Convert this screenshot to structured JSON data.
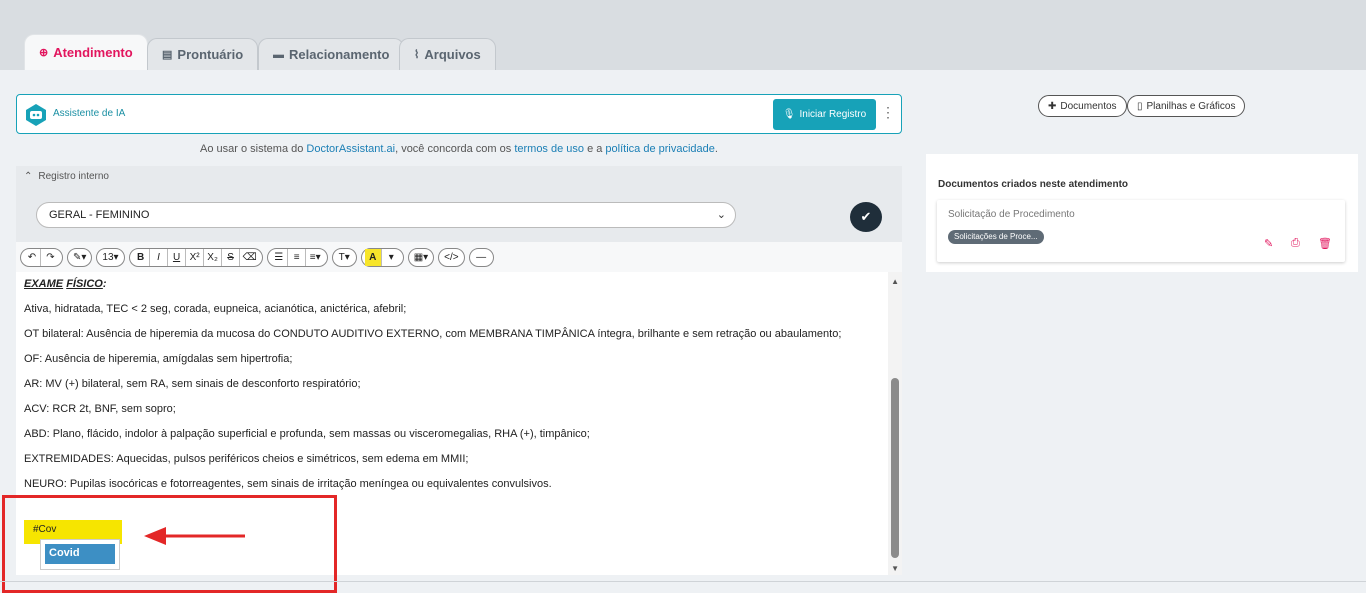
{
  "tabs": [
    {
      "label": "Atendimento",
      "icon": "stethoscope-icon",
      "active": true
    },
    {
      "label": "Prontuário",
      "icon": "document-icon",
      "active": false
    },
    {
      "label": "Relacionamento",
      "icon": "chat-icon",
      "active": false
    },
    {
      "label": "Arquivos",
      "icon": "paperclip-icon",
      "active": false
    }
  ],
  "ai": {
    "label": "Assistente de IA",
    "start_button": "Iniciar Registro",
    "consent_prefix": "Ao usar o sistema do ",
    "consent_site": "DoctorAssistant.ai",
    "consent_mid": ", você concorda com os ",
    "consent_terms": "termos de uso",
    "consent_and": " e a ",
    "consent_privacy": "política de privacidade",
    "consent_end": "."
  },
  "registro": {
    "header": "Registro interno",
    "template_selected": "GERAL - FEMININO"
  },
  "toolbar": {
    "font_size": "13"
  },
  "editor": {
    "heading_1": "EXAME",
    "heading_2": "FÍSICO",
    "heading_colon": ":",
    "lines": [
      "Ativa, hidratada, TEC < 2 seg, corada, eupneica, acianótica, anictérica, afebril;",
      "OT bilateral: Ausência de hiperemia da mucosa do CONDUTO AUDITIVO EXTERNO, com MEMBRANA TIMPÂNICA íntegra, brilhante e sem retração ou abaulamento;",
      "OF: Ausência de hiperemia, amígdalas sem hipertrofia;",
      "AR: MV (+) bilateral, sem RA, sem sinais de desconforto respiratório;",
      "ACV: RCR 2t, BNF, sem sopro;",
      "ABD: Plano, flácido, indolor à palpação superficial e profunda, sem massas ou visceromegalias, RHA (+), timpânico;",
      "EXTREMIDADES: Aquecidas, pulsos periféricos cheios e simétricos, sem edema em MMII;",
      "NEURO: Pupilas isocóricas e fotorreagentes, sem sinais de irritação meníngea ou equivalentes convulsivos."
    ],
    "hashtag": "#Cov",
    "suggestion": "Covid"
  },
  "right": {
    "btn_documentos": "Documentos",
    "btn_planilhas": "Planilhas e Gráficos",
    "docs_title": "Documentos criados neste atendimento",
    "doc_name": "Solicitação de Procedimento",
    "doc_badge": "Solicitações de Proce..."
  },
  "colors": {
    "accent": "#e2165e",
    "teal": "#17a2b8",
    "highlight": "#f6e500",
    "annotation_red": "#e32727"
  }
}
